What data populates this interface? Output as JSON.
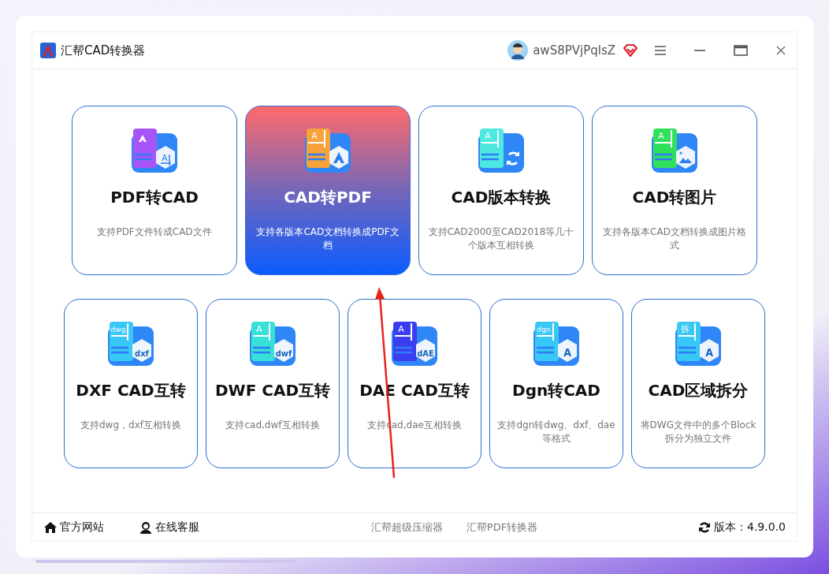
{
  "window": {
    "title": "汇帮CAD转换器",
    "user": "awS8PVjPqlsZ"
  },
  "top_cards": [
    {
      "title": "PDF转CAD",
      "desc": "支持PDF文件转成CAD文件",
      "selected": false,
      "icon": {
        "color": "#a855f7",
        "kind": "cad",
        "badge": "A"
      }
    },
    {
      "title": "CAD转PDF",
      "desc": "支持各版本CAD文档转换成PDF文档",
      "selected": true,
      "icon": {
        "color": "#f7a23b",
        "kind": "pdf",
        "tag": "A"
      }
    },
    {
      "title": "CAD版本转换",
      "desc": "支持CAD2000至CAD2018等几十个版本互相转换",
      "selected": false,
      "icon": {
        "color": "#4de8e0",
        "kind": "swap",
        "tag": "A"
      }
    },
    {
      "title": "CAD转图片",
      "desc": "支持各版本CAD文档转换成图片格式",
      "selected": false,
      "icon": {
        "color": "#2fe05a",
        "kind": "image",
        "tag": "A"
      }
    }
  ],
  "bottom_cards": [
    {
      "title": "DXF CAD互转",
      "desc": "支持dwg，dxf互相转换",
      "selected": false,
      "icon": {
        "color": "#38c8f5",
        "tag": "dwg",
        "badge": "dxf"
      }
    },
    {
      "title": "DWF CAD互转",
      "desc": "支持cad,dwf互相转换",
      "selected": false,
      "icon": {
        "color": "#38e0d8",
        "tag": "A",
        "badge": "dwf"
      }
    },
    {
      "title": "DAE CAD互转",
      "desc": "支持cad,dae互相转换",
      "selected": false,
      "icon": {
        "color": "#3b3df0",
        "tag": "A",
        "badge": "dAE"
      }
    },
    {
      "title": "Dgn转CAD",
      "desc": "支持dgn转dwg、dxf、dae等格式",
      "selected": false,
      "icon": {
        "color": "#38c8f5",
        "tag": "dgn",
        "badge": "A"
      }
    },
    {
      "title": "CAD区域拆分",
      "desc": "将DWG文件中的多个Block拆分为独立文件",
      "selected": false,
      "icon": {
        "color": "#38c8f5",
        "tag": "拆",
        "badge": "A"
      }
    }
  ],
  "footer": {
    "left": [
      {
        "label": "官方网站",
        "kind": "home"
      },
      {
        "label": "在线客服",
        "kind": "support"
      }
    ],
    "center": [
      "汇帮超级压缩器",
      "汇帮PDF转换器"
    ],
    "version": "版本：4.9.0.0"
  }
}
